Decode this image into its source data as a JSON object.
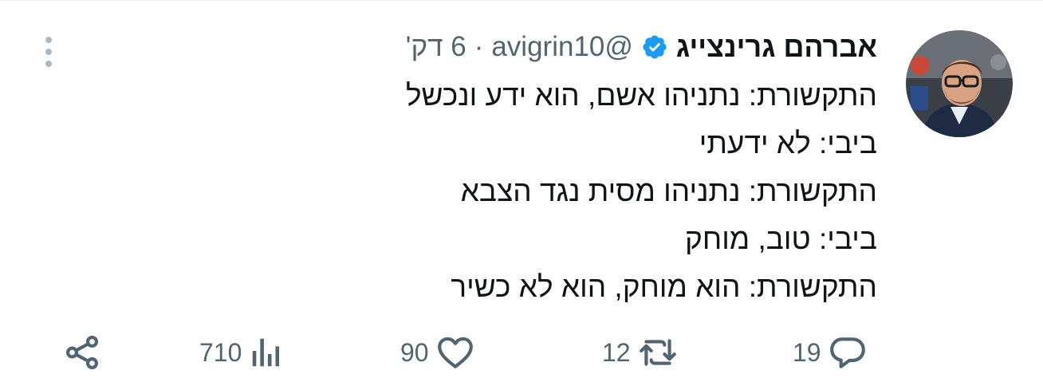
{
  "tweet": {
    "author": {
      "name": "אברהם גרינצייג",
      "handle": "@avigrin10",
      "verified": true
    },
    "separator": "·",
    "time_ago": "6 דק'",
    "lines": [
      "התקשורת: נתניהו אשם, הוא ידע ונכשל",
      "ביבי: לא ידעתי",
      "התקשורת: נתניהו מסית נגד הצבא",
      "ביבי: טוב, מוחק",
      "התקשורת: הוא מוחק, הוא לא כשיר"
    ],
    "actions": {
      "replies": "19",
      "retweets": "12",
      "likes": "90",
      "views": "710"
    }
  },
  "icons": {
    "more": "more-vertical-icon",
    "verified": "verified-badge-icon",
    "reply": "reply-icon",
    "retweet": "retweet-icon",
    "like": "heart-icon",
    "views": "views-chart-icon",
    "share": "share-icon"
  },
  "colors": {
    "text": "#0f1419",
    "secondary": "#536471",
    "verified": "#1d9bf0",
    "more_dots": "#aab8c2"
  }
}
